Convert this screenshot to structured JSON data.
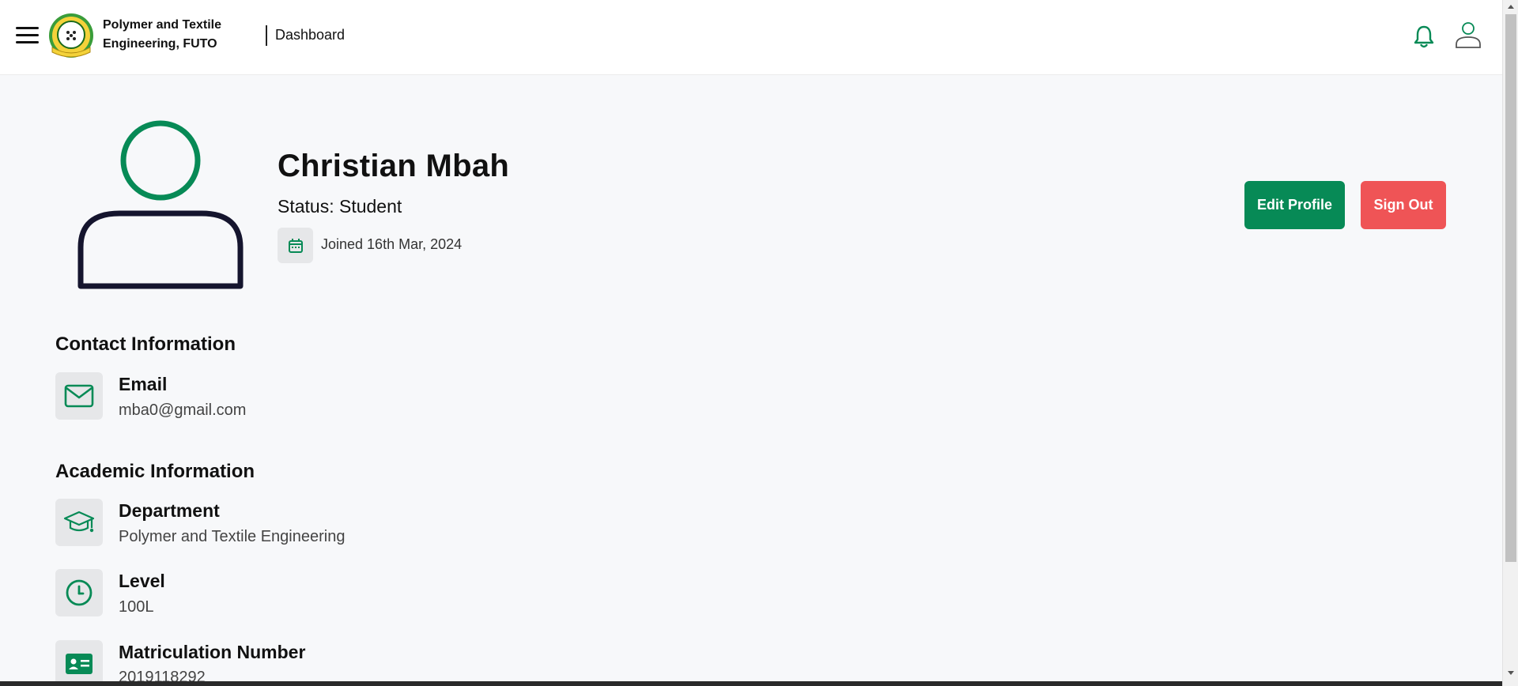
{
  "header": {
    "brand_line1": "Polymer and Textile",
    "brand_line2": "Engineering, FUTO",
    "breadcrumb": "Dashboard",
    "icons": [
      "menu-icon",
      "bell-icon",
      "user-icon"
    ]
  },
  "profile": {
    "name": "Christian Mbah",
    "status": "Status: Student",
    "joined": "Joined 16th Mar, 2024",
    "edit_button": "Edit Profile",
    "signout_button": "Sign Out"
  },
  "contact": {
    "title": "Contact Information",
    "email_label": "Email",
    "email_value": "mba0@gmail.com"
  },
  "academic": {
    "title": "Academic Information",
    "department_label": "Department",
    "department_value": "Polymer and Textile Engineering",
    "level_label": "Level",
    "level_value": "100L",
    "matric_label": "Matriculation Number",
    "matric_value": "2019118292"
  },
  "colors": {
    "accent_green": "#078a56",
    "danger_red": "#ef5456",
    "avatar_dark": "#15152e",
    "icon_bg": "#e6e7e9",
    "page_bg": "#f7f8fa"
  }
}
